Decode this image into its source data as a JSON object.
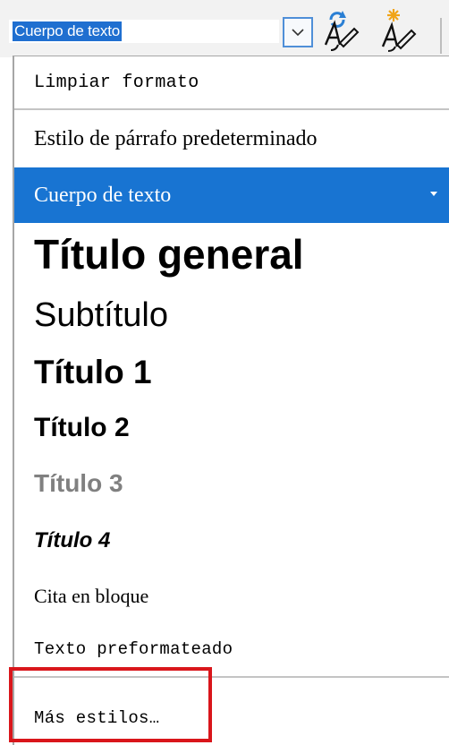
{
  "toolbar": {
    "style_box_value": "Cuerpo de texto",
    "dropdown_icon": "chevron-down-icon",
    "update_style_icon": "update-style-icon",
    "new_style_icon": "new-style-icon"
  },
  "dropdown": {
    "items": [
      {
        "label": "Limpiar formato"
      },
      {
        "label": "Estilo de párrafo predeterminado"
      },
      {
        "label": "Cuerpo de texto",
        "selected": true
      },
      {
        "label": "Título general"
      },
      {
        "label": "Subtítulo"
      },
      {
        "label": "Título 1"
      },
      {
        "label": "Título 2"
      },
      {
        "label": "Título 3"
      },
      {
        "label": "Título 4"
      },
      {
        "label": "Cita en bloque"
      },
      {
        "label": "Texto preformateado"
      },
      {
        "label": "Más estilos…"
      }
    ]
  },
  "colors": {
    "selection": "#1874d2",
    "highlight_box": "#d9161b",
    "heading3_gray": "#808080"
  }
}
